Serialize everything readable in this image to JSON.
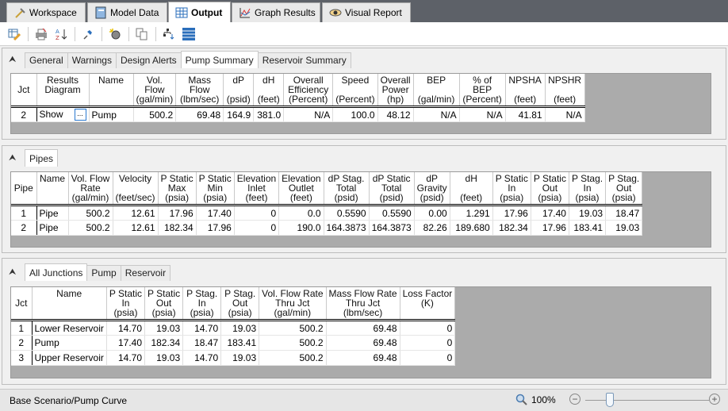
{
  "main_tabs": [
    {
      "label": "Workspace",
      "icon": "hammer-icon",
      "active": false
    },
    {
      "label": "Model Data",
      "icon": "notebook-icon",
      "active": false
    },
    {
      "label": "Output",
      "icon": "table-icon",
      "active": true
    },
    {
      "label": "Graph Results",
      "icon": "graph-icon",
      "active": false
    },
    {
      "label": "Visual Report",
      "icon": "eye-icon",
      "active": false
    }
  ],
  "toolbar": [
    "edit-table-icon",
    "print-icon",
    "sort-az-icon",
    "pin-icon",
    "highlight-icon",
    "copy-icon",
    "hierarchy-icon",
    "rows-icon"
  ],
  "pump_panel": {
    "tabs": [
      "General",
      "Warnings",
      "Design Alerts",
      "Pump Summary",
      "Reservoir Summary"
    ],
    "active_tab": "Pump Summary",
    "headers": [
      [
        "",
        "Jct",
        ""
      ],
      [
        "Results",
        "Diagram",
        ""
      ],
      [
        "Name",
        "",
        ""
      ],
      [
        "Vol.",
        "Flow",
        "(gal/min)"
      ],
      [
        "Mass",
        "Flow",
        "(lbm/sec)"
      ],
      [
        "dP",
        "",
        "(psid)"
      ],
      [
        "dH",
        "",
        "(feet)"
      ],
      [
        "Overall",
        "Efficiency",
        "(Percent)"
      ],
      [
        "Speed",
        "",
        "(Percent)"
      ],
      [
        "Overall",
        "Power",
        "(hp)"
      ],
      [
        "BEP",
        "",
        "(gal/min)"
      ],
      [
        "% of",
        "BEP",
        "(Percent)"
      ],
      [
        "NPSHA",
        "",
        "(feet)"
      ],
      [
        "NPSHR",
        "",
        "(feet)"
      ]
    ],
    "rows": [
      [
        "2",
        "Show",
        "Pump",
        "500.2",
        "69.48",
        "164.9",
        "381.0",
        "N/A",
        "100.0",
        "48.12",
        "N/A",
        "N/A",
        "41.81",
        "N/A"
      ]
    ]
  },
  "pipes_panel": {
    "tabs": [
      "Pipes"
    ],
    "active_tab": "Pipes",
    "headers": [
      [
        "",
        "Pipe",
        ""
      ],
      [
        "Name",
        "",
        ""
      ],
      [
        "Vol. Flow",
        "Rate",
        "(gal/min)"
      ],
      [
        "Velocity",
        "",
        "(feet/sec)"
      ],
      [
        "P Static",
        "Max",
        "(psia)"
      ],
      [
        "P Static",
        "Min",
        "(psia)"
      ],
      [
        "Elevation",
        "Inlet",
        "(feet)"
      ],
      [
        "Elevation",
        "Outlet",
        "(feet)"
      ],
      [
        "dP Stag.",
        "Total",
        "(psid)"
      ],
      [
        "dP Static",
        "Total",
        "(psid)"
      ],
      [
        "dP",
        "Gravity",
        "(psid)"
      ],
      [
        "dH",
        "",
        "(feet)"
      ],
      [
        "P Static",
        "In",
        "(psia)"
      ],
      [
        "P Static",
        "Out",
        "(psia)"
      ],
      [
        "P Stag.",
        "In",
        "(psia)"
      ],
      [
        "P Stag.",
        "Out",
        "(psia)"
      ]
    ],
    "rows": [
      [
        "1",
        "Pipe",
        "500.2",
        "12.61",
        "17.96",
        "17.40",
        "0",
        "0.0",
        "0.5590",
        "0.5590",
        "0.00",
        "1.291",
        "17.96",
        "17.40",
        "19.03",
        "18.47"
      ],
      [
        "2",
        "Pipe",
        "500.2",
        "12.61",
        "182.34",
        "17.96",
        "0",
        "190.0",
        "164.3873",
        "164.3873",
        "82.26",
        "189.680",
        "182.34",
        "17.96",
        "183.41",
        "19.03"
      ]
    ]
  },
  "junctions_panel": {
    "tabs": [
      "All Junctions",
      "Pump",
      "Reservoir"
    ],
    "active_tab": "All Junctions",
    "headers": [
      [
        "",
        "Jct",
        ""
      ],
      [
        "Name",
        "",
        ""
      ],
      [
        "P Static",
        "In",
        "(psia)"
      ],
      [
        "P Static",
        "Out",
        "(psia)"
      ],
      [
        "P Stag.",
        "In",
        "(psia)"
      ],
      [
        "P Stag.",
        "Out",
        "(psia)"
      ],
      [
        "Vol. Flow Rate",
        "Thru Jct",
        "(gal/min)"
      ],
      [
        "Mass Flow Rate",
        "Thru Jct",
        "(lbm/sec)"
      ],
      [
        "Loss Factor",
        "(K)",
        ""
      ]
    ],
    "rows": [
      [
        "1",
        "Lower Reservoir",
        "14.70",
        "19.03",
        "14.70",
        "19.03",
        "500.2",
        "69.48",
        "0"
      ],
      [
        "2",
        "Pump",
        "17.40",
        "182.34",
        "18.47",
        "183.41",
        "500.2",
        "69.48",
        "0"
      ],
      [
        "3",
        "Upper Reservoir",
        "14.70",
        "19.03",
        "14.70",
        "19.03",
        "500.2",
        "69.48",
        "0"
      ]
    ]
  },
  "status": {
    "scenario": "Base Scenario/Pump Curve",
    "zoom": "100%",
    "zoom_fraction": 0.2
  }
}
